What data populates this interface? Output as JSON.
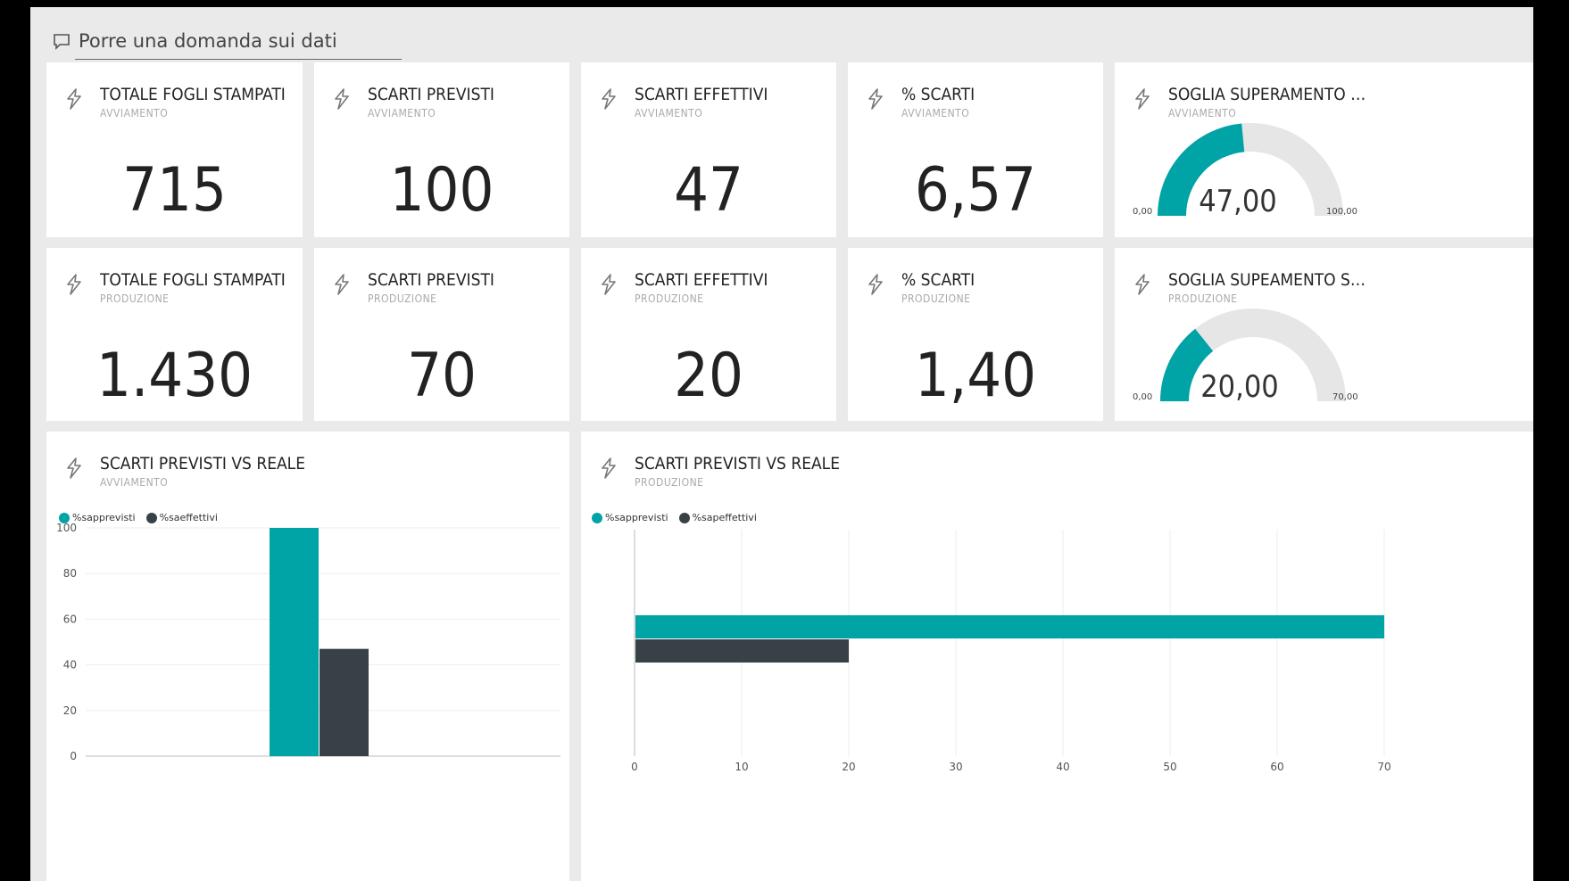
{
  "qa": {
    "placeholder": "Porre una domanda sui dati"
  },
  "colors": {
    "teal": "#00a3a6",
    "dark": "#374146",
    "track": "#e6e6e6"
  },
  "row1": [
    {
      "title": "TOTALE FOGLI STAMPATI",
      "subtitle": "AVVIAMENTO",
      "value": "715"
    },
    {
      "title": "SCARTI PREVISTI",
      "subtitle": "AVVIAMENTO",
      "value": "100"
    },
    {
      "title": "SCARTI EFFETTIVI",
      "subtitle": "AVVIAMENTO",
      "value": "47"
    },
    {
      "title": "% SCARTI",
      "subtitle": "AVVIAMENTO",
      "value": "6,57"
    }
  ],
  "row2": [
    {
      "title": "TOTALE FOGLI STAMPATI",
      "subtitle": "PRODUZIONE",
      "value": "1.430"
    },
    {
      "title": "SCARTI PREVISTI",
      "subtitle": "PRODUZIONE",
      "value": "70"
    },
    {
      "title": "SCARTI EFFETTIVI",
      "subtitle": "PRODUZIONE",
      "value": "20"
    },
    {
      "title": "% SCARTI",
      "subtitle": "PRODUZIONE",
      "value": "1,40"
    }
  ],
  "gauges": [
    {
      "title": "SOGLIA SUPERAMENTO SCARTI",
      "subtitle": "AVVIAMENTO",
      "value_label": "47,00",
      "min_label": "0,00",
      "max_label": "100,00",
      "value": 47,
      "min": 0,
      "max": 100
    },
    {
      "title": "SOGLIA SUPEAMENTO SCARTI",
      "subtitle": "PRODUZIONE",
      "value_label": "20,00",
      "min_label": "0,00",
      "max_label": "70,00",
      "value": 20,
      "min": 0,
      "max": 70
    }
  ],
  "charts": {
    "avviamento": {
      "title": "SCARTI PREVISTI VS REALE",
      "subtitle": "AVVIAMENTO",
      "legend": [
        "%sapprevisti",
        "%saeffettivi"
      ]
    },
    "produzione": {
      "title": "SCARTI PREVISTI VS REALE",
      "subtitle": "PRODUZIONE",
      "legend": [
        "%sapprevisti",
        "%sapeffettivi"
      ]
    }
  },
  "chart_data": [
    {
      "type": "bar",
      "orientation": "vertical",
      "series": [
        {
          "name": "%sapprevisti",
          "values": [
            100
          ]
        },
        {
          "name": "%saeffettivi",
          "values": [
            47
          ]
        }
      ],
      "ylim": [
        0,
        100
      ],
      "yticks": [
        "0",
        "20",
        "40",
        "60",
        "80",
        "100"
      ],
      "grid": true,
      "legend": "top-left"
    },
    {
      "type": "bar",
      "orientation": "horizontal",
      "series": [
        {
          "name": "%sapprevisti",
          "values": [
            70
          ]
        },
        {
          "name": "%sapeffettivi",
          "values": [
            20
          ]
        }
      ],
      "xlim": [
        0,
        70
      ],
      "xticks": [
        "0",
        "10",
        "20",
        "30",
        "40",
        "50",
        "60",
        "70"
      ],
      "grid": true,
      "legend": "top-left"
    }
  ]
}
